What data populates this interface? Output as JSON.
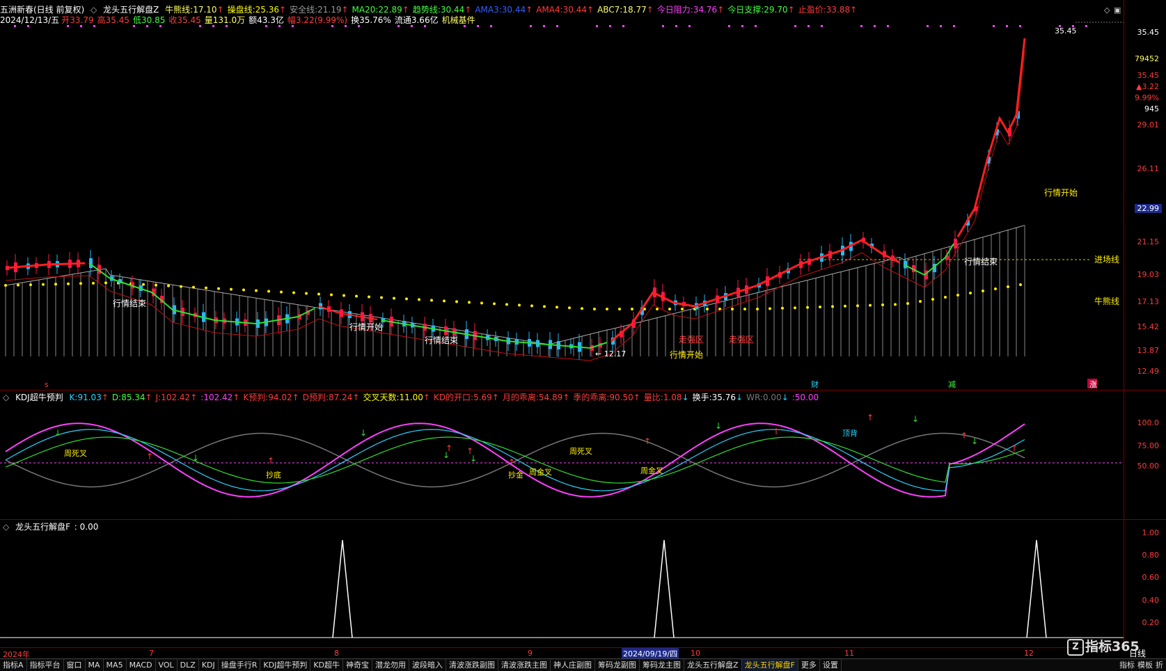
{
  "header1": {
    "title": "五洲新春(日线 前复权)",
    "indicator": "龙头五行解盘Z",
    "items": [
      {
        "label": "牛熊线:",
        "value": "17.10",
        "color": "#ffff66",
        "arrow": "up"
      },
      {
        "label": "操盘线:",
        "value": "25.36",
        "color": "#ffff00",
        "arrow": "up"
      },
      {
        "label": "安全线:",
        "value": "21.19",
        "color": "#999999",
        "arrow": "up"
      },
      {
        "label": "MA20:",
        "value": "22.89",
        "color": "#40ff40",
        "arrow": "up"
      },
      {
        "label": "趋势线:",
        "value": "30.44",
        "color": "#40ff40",
        "arrow": "up"
      },
      {
        "label": "AMA3:",
        "value": "30.44",
        "color": "#3060ff",
        "arrow": "up"
      },
      {
        "label": "AMA4:",
        "value": "30.44",
        "color": "#ff3b3b",
        "arrow": "up"
      },
      {
        "label": "ABC7:",
        "value": "18.77",
        "color": "#ffff66",
        "arrow": "up"
      },
      {
        "label": "今日阻力:",
        "value": "34.76",
        "color": "#ff40ff",
        "arrow": "up"
      },
      {
        "label": "今日支撑:",
        "value": "29.70",
        "color": "#40ff40",
        "arrow": "up"
      },
      {
        "label": "止盈价:",
        "value": "33.88",
        "color": "#ff3b3b",
        "arrow": "up"
      }
    ]
  },
  "header2": {
    "date": "2024/12/13/五",
    "open_label": "开",
    "open": "33.79",
    "high_label": "高",
    "high": "35.45",
    "low_label": "低",
    "low": "30.85",
    "close_label": "收",
    "close": "35.45",
    "vol_label": "量",
    "vol": "131.0万",
    "amt_label": "额",
    "amt": "43.3亿",
    "chg_label": "幅",
    "chg": "3.22(9.99%)",
    "turn_label": "换",
    "turn": "35.76%",
    "float_label": "流通",
    "float": "3.66亿",
    "sector": "机械基件"
  },
  "main_axis": [
    "35.45",
    "79452",
    "35.45",
    "▲3.22",
    "9.99%",
    "945",
    "29.01",
    "26.11",
    "22.99",
    "21.15",
    "19.03",
    "17.13",
    "15.42",
    "13.87",
    "12.49"
  ],
  "main_axis_colors": [
    "#ffffff",
    "#ffff66",
    "#ff3b3b",
    "#ff3b3b",
    "#ff3b3b",
    "#ffffff",
    "#ff3b3b",
    "#ff3b3b",
    "#ffffff",
    "#ff3b3b",
    "#ff3b3b",
    "#ff3b3b",
    "#ff3b3b",
    "#ff3b3b",
    "#ff3b3b"
  ],
  "main_labels": {
    "peak": "35.45",
    "low": "12.17",
    "entry": "进场线",
    "bull": "牛熊线",
    "start1": "行情开始",
    "start2": "行情开始",
    "start3": "行情开始",
    "end1": "行情结束",
    "end2": "行情结束",
    "end3": "行情结束",
    "strong1": "走强区",
    "strong2": "走强区",
    "cai": "财",
    "jian": "减",
    "zhang": "涨",
    "s": "s"
  },
  "kdj_header": {
    "name": "KDJ超牛预判",
    "items": [
      {
        "label": "K:",
        "value": "91.03",
        "color": "#29d3ff",
        "arrow": "up"
      },
      {
        "label": "D:",
        "value": "85.34",
        "color": "#40ff40",
        "arrow": "up"
      },
      {
        "label": "J:",
        "value": "102.42",
        "color": "#ff3b3b",
        "arrow": "up"
      },
      {
        "label": ":",
        "value": "102.42",
        "color": "#ff40ff",
        "arrow": "up"
      },
      {
        "label": "K预判:",
        "value": "94.02",
        "color": "#ff3b3b",
        "arrow": "up"
      },
      {
        "label": "D预判:",
        "value": "87.24",
        "color": "#ff3b3b",
        "arrow": "up"
      },
      {
        "label": "交叉天数:",
        "value": "11.00",
        "color": "#ffff00",
        "arrow": "up"
      },
      {
        "label": "KD的开口:",
        "value": "5.69",
        "color": "#ff3b3b",
        "arrow": "up"
      },
      {
        "label": "月的乖离:",
        "value": "54.89",
        "color": "#ff3b3b",
        "arrow": "up"
      },
      {
        "label": "季的乖离:",
        "value": "90.50",
        "color": "#ff3b3b",
        "arrow": "up"
      },
      {
        "label": "量比:",
        "value": "1.08",
        "color": "#ff3b3b",
        "arrow": "dn"
      },
      {
        "label": "换手:",
        "value": "35.76",
        "color": "#ffffff",
        "arrow": "dn"
      },
      {
        "label": "WR:",
        "value": "0.00",
        "color": "#777777",
        "arrow": "dn"
      },
      {
        "label": ":",
        "value": "50.00",
        "color": "#ff40ff",
        "arrow": ""
      }
    ]
  },
  "kdj_axis": [
    "100.0",
    "75.00",
    "50.00"
  ],
  "kdj_labels": {
    "a": "周死叉",
    "b": "抄底",
    "c": "抄金",
    "d": "周金叉",
    "e": "周死叉",
    "f": "周金叉",
    "g": "顶背"
  },
  "f_header": {
    "name": "龙头五行解盘F",
    "value": ": 0.00"
  },
  "f_axis": [
    "1.00",
    "0.80",
    "0.60",
    "0.40",
    "0.20"
  ],
  "date_axis": {
    "year": "2024年",
    "m7": "7",
    "m8": "8",
    "m9": "9",
    "hl": "2024/09/19/四",
    "m10": "10",
    "m11": "11",
    "m12": "12"
  },
  "tabs": [
    "指标A",
    "指标平台",
    "窗口",
    "MA",
    "MA5",
    "MACD",
    "VOL",
    "DLZ",
    "KDJ",
    "操盘手行R",
    "KDJ超牛预判",
    "KD超牛",
    "神奇宝",
    "潜龙勿用",
    "波段暗入",
    "清波涨跌副图",
    "清波涨跌主图",
    "神人庄副图",
    "筹码龙副图",
    "筹码龙主图",
    "龙头五行解盘Z",
    "龙头五行解盘F",
    "更多",
    "设置"
  ],
  "active_tab": "龙头五行解盘F",
  "bottom_right": [
    "指标",
    "模板",
    "折"
  ],
  "watermark": "指标365",
  "period": "日线",
  "window_icons": [
    "◇",
    "▣"
  ]
}
